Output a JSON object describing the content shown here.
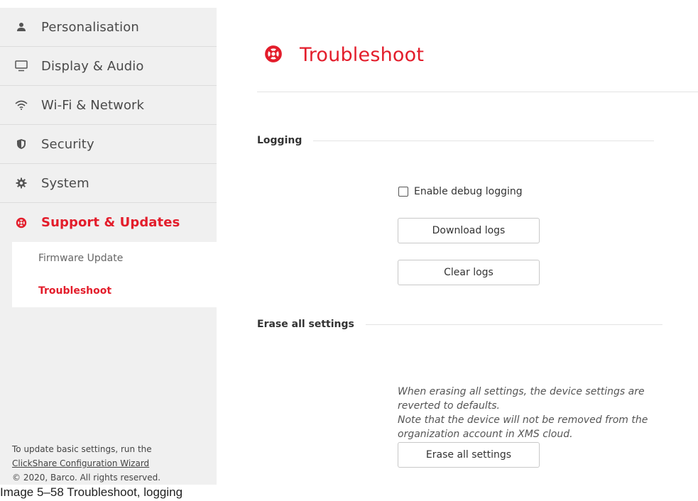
{
  "sidebar": {
    "items": [
      {
        "label": "Personalisation",
        "icon": "user-icon"
      },
      {
        "label": "Display & Audio",
        "icon": "monitor-icon"
      },
      {
        "label": "Wi-Fi & Network",
        "icon": "wifi-icon"
      },
      {
        "label": "Security",
        "icon": "shield-icon"
      },
      {
        "label": "System",
        "icon": "gear-icon"
      },
      {
        "label": "Support & Updates",
        "icon": "lifebuoy-icon",
        "active": true
      }
    ],
    "subitems": [
      {
        "label": "Firmware Update"
      },
      {
        "label": "Troubleshoot",
        "active": true
      }
    ],
    "footer": {
      "line1": "To update basic settings, run the",
      "wizard_link": "ClickShare Configuration Wizard",
      "copyright": "© 2020, Barco. All rights reserved."
    }
  },
  "main": {
    "title": "Troubleshoot",
    "logging": {
      "heading": "Logging",
      "debug_label": "Enable debug logging",
      "debug_checked": false,
      "download_label": "Download logs",
      "clear_label": "Clear logs"
    },
    "erase": {
      "heading": "Erase all settings",
      "note_line1": "When erasing all settings, the device settings are reverted to defaults.",
      "note_line2": "Note that the device will not be removed from the organization account in XMS cloud.",
      "button_label": "Erase all settings"
    }
  },
  "caption": "Image 5–58  Troubleshoot, logging",
  "colors": {
    "accent": "#e31d2b",
    "sidebar_bg": "#f0f0f0"
  }
}
